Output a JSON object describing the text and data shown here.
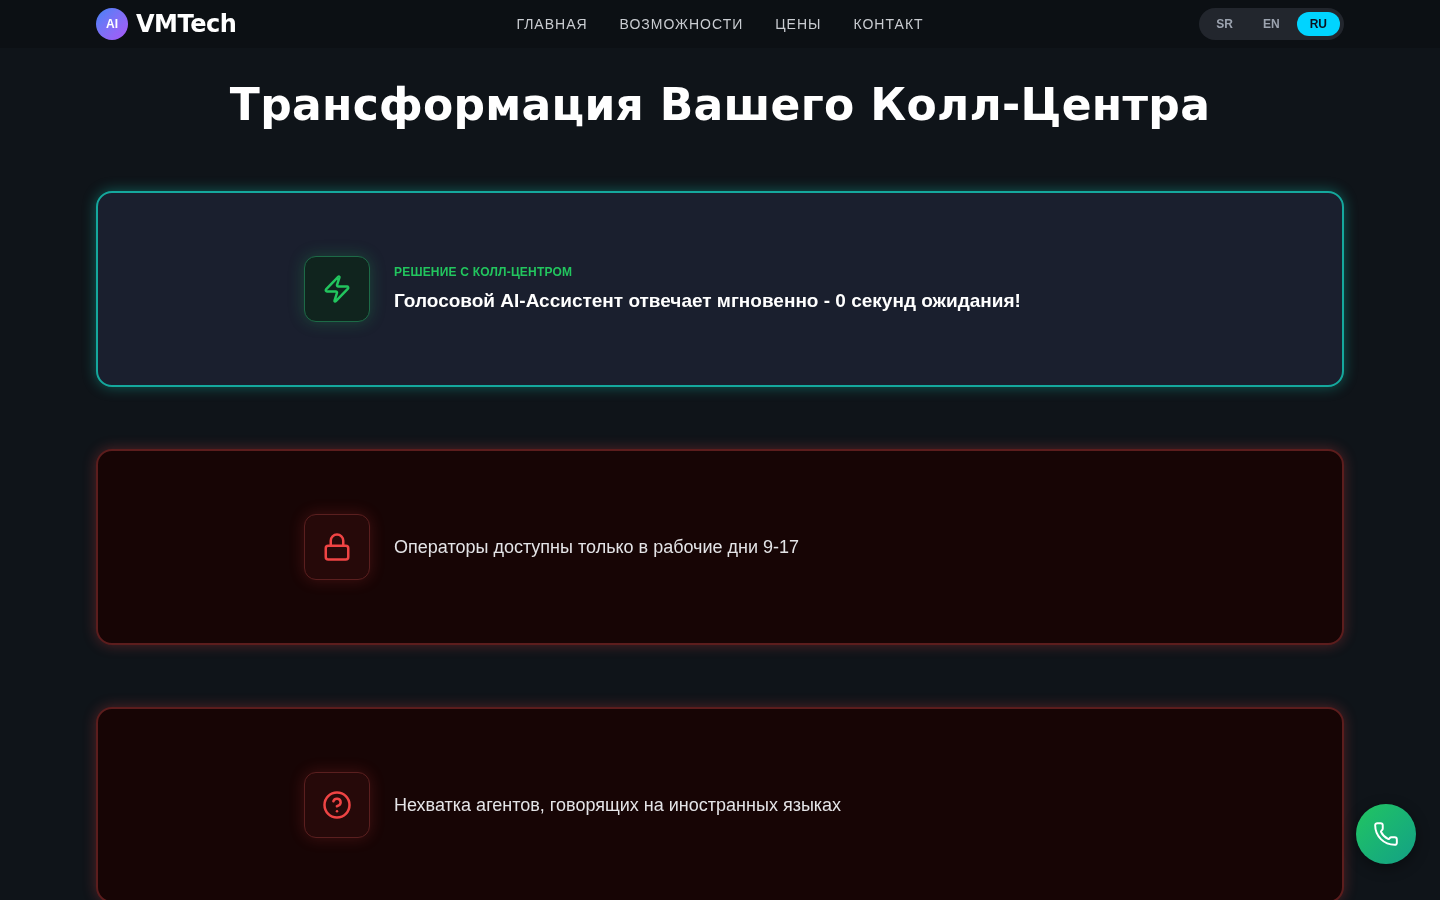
{
  "header": {
    "logo_badge": "AI",
    "brand": "VMTech",
    "nav": [
      "ГЛАВНАЯ",
      "ВОЗМОЖНОСТИ",
      "ЦЕНЫ",
      "КОНТАКТ"
    ],
    "languages": [
      {
        "label": "SR",
        "selected": false
      },
      {
        "label": "EN",
        "selected": false
      },
      {
        "label": "RU",
        "selected": true
      }
    ]
  },
  "hero": {
    "title": "Трансформация Вашего Колл-Центра"
  },
  "cards": [
    {
      "kind": "solution",
      "label": "РЕШЕНИЕ С КОЛЛ-ЦЕНТРОМ",
      "title": "Голосовой AI-Ассистент отвечает мгновенно - 0 секунд ожидания!"
    },
    {
      "kind": "problem",
      "text": "Операторы доступны только в рабочие дни 9-17"
    },
    {
      "kind": "problem",
      "text": "Нехватка агентов, говорящих на иностранных языках"
    }
  ]
}
